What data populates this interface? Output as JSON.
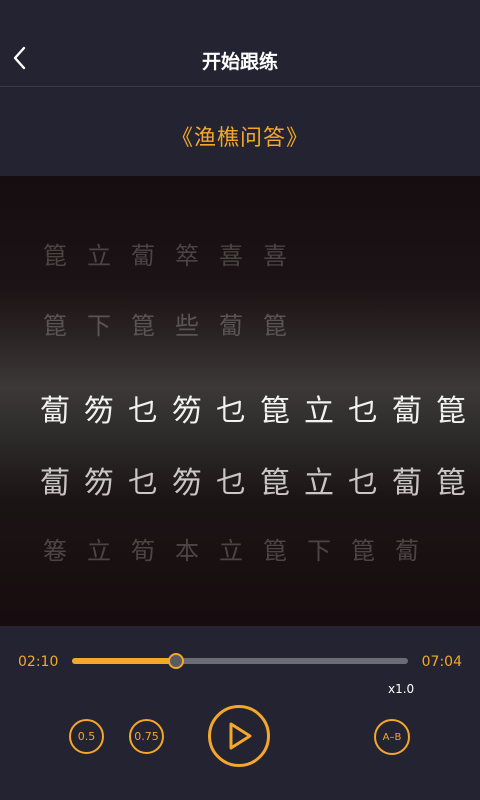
{
  "header": {
    "title": "开始跟练",
    "back_icon": "chevron-left-icon"
  },
  "piece": {
    "title": "《渔樵问答》"
  },
  "score": {
    "rows": [
      [
        "箟",
        "立",
        "蔔",
        "箤",
        "喜",
        "喜"
      ],
      [
        "箟",
        "下",
        "箟",
        "些",
        "蔔",
        "箟"
      ],
      [
        "蔔",
        "笏",
        "乜",
        "笏",
        "乜",
        "箟",
        "立",
        "乜",
        "蔔",
        "箟"
      ],
      [
        "蔔",
        "笏",
        "乜",
        "笏",
        "乜",
        "箟",
        "立",
        "乜",
        "蔔",
        "箟"
      ],
      [
        "箞",
        "立",
        "筍",
        "本",
        "立",
        "箟",
        "下",
        "箟",
        "蔔"
      ]
    ]
  },
  "player": {
    "current_time": "02:10",
    "total_time": "07:04",
    "progress": 0.31,
    "speed": "x1.0",
    "buttons": {
      "speed_05": "0.5",
      "speed_075": "0.75",
      "ab_repeat": "A–B"
    },
    "play_icon": "play-icon"
  },
  "colors": {
    "accent": "#f4a72a",
    "background": "#232331"
  }
}
